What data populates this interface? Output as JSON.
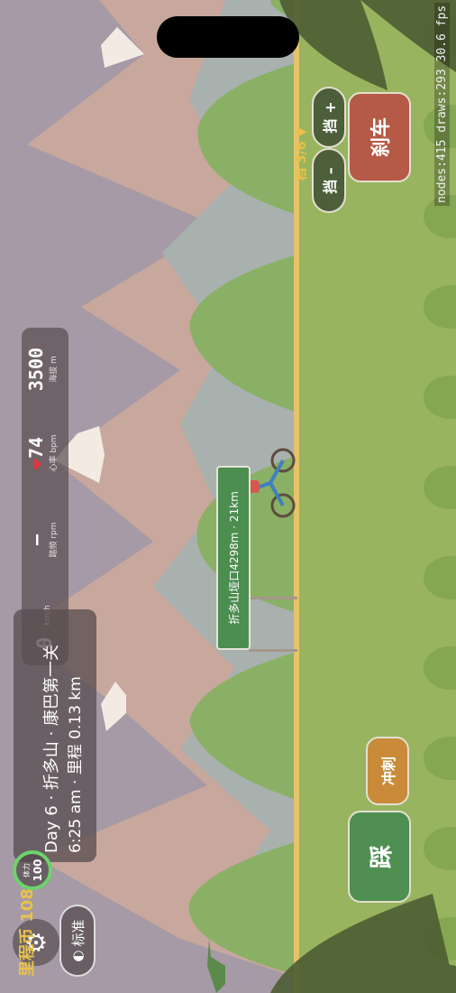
{
  "colors": {
    "sky": "#9bb4b8",
    "far_mountain": "#c5a79f",
    "mid_mountain": "#a8b3b2",
    "near_hill": "#8fb063",
    "ground": "#98b45f",
    "road": "#e6c36a",
    "brake_button": "#b55a46",
    "pedal_button": "#4f8f52",
    "sprint_button": "#c98b3a",
    "gear_button": "#4d5e3a",
    "coin_text": "#e8c24a",
    "stamina_ring": "#6cd36b"
  },
  "hud": {
    "coin_label": "里程币",
    "coin_value": "108",
    "settings_icon": "gear-icon",
    "mode_label": "标准",
    "mode_icon": "half-circle-icon",
    "stamina_label": "体力",
    "stamina_value": "100",
    "stage_title": "Day 6 · 折多山 · 康巴第一关",
    "stage_sub": "6:25 am · 里程 0.13 km",
    "stats": {
      "speed_value": "0",
      "speed_unit": "km/h",
      "cadence_value": "–",
      "cadence_label": "踏频 rpm",
      "heart_icon": "heart-icon",
      "heart_value": "74",
      "heart_label": "心率 bpm",
      "altitude_value": "3500",
      "altitude_label": "海拔 m"
    },
    "gear_indicator": "档 3/6 ▼",
    "debug": "nodes:415 draws:293  30.6 fps"
  },
  "scene": {
    "sign_text": "折多山垭口4298m · 21km"
  },
  "controls": {
    "gear_down": "挡 –",
    "gear_up": "挡 +",
    "brake": "刹车",
    "sprint": "冲刺",
    "pedal": "踩"
  }
}
